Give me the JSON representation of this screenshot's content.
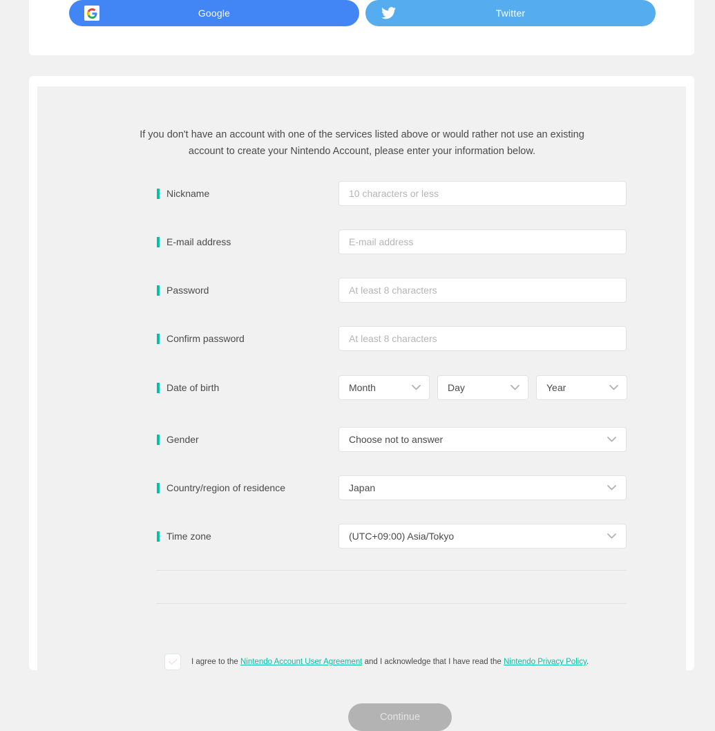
{
  "social": {
    "buttons": [
      {
        "label": "Google",
        "icon": "google-icon",
        "color": "#4285f4"
      },
      {
        "label": "Twitter",
        "icon": "twitter-icon",
        "color": "#55acee"
      }
    ]
  },
  "form": {
    "intro": "If you don't have an account with one of the services listed above or would rather not use an existing account to create your Nintendo Account, please enter your information below.",
    "required_marker_color": "#00c3a5",
    "fields": [
      {
        "label": "Nickname",
        "placeholder": "10 characters or less",
        "type": "text"
      },
      {
        "label": "E-mail address",
        "placeholder": "E-mail address",
        "type": "text"
      },
      {
        "label": "Password",
        "placeholder": "At least 8 characters",
        "type": "password"
      },
      {
        "label": "Confirm password",
        "placeholder": "At least 8 characters",
        "type": "password"
      }
    ],
    "date_of_birth": {
      "label": "Date of birth",
      "month": "Month",
      "day": "Day",
      "year": "Year"
    },
    "gender": {
      "label": "Gender",
      "value": "Choose not to answer"
    },
    "country": {
      "label": "Country/region of residence",
      "value": "Japan"
    },
    "timezone": {
      "label": "Time zone",
      "value": "(UTC+09:00) Asia/Tokyo"
    }
  },
  "agreement": {
    "text_before": "I agree to the ",
    "link_user_agreement": "Nintendo Account User Agreement",
    "text_middle": " and I acknowledge that I have read the ",
    "link_privacy_policy": "Nintendo Privacy Policy",
    "text_after": ".",
    "link_color": "#00c3a5",
    "checked": false
  },
  "submit": {
    "label": "Continue",
    "enabled": false
  }
}
